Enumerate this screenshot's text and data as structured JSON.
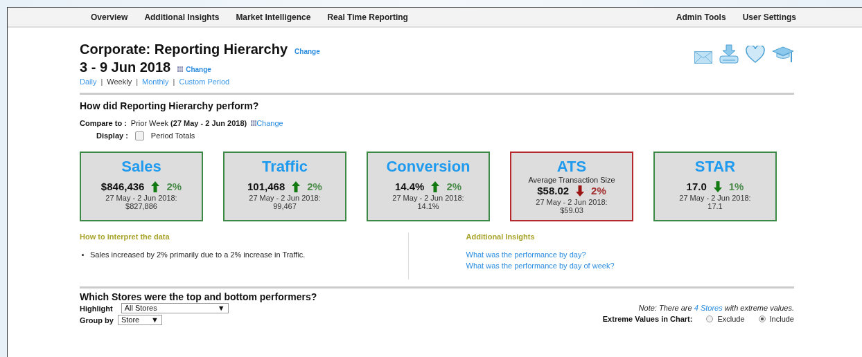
{
  "nav": {
    "left": [
      {
        "label": "Overview"
      },
      {
        "label": "Additional Insights"
      },
      {
        "label": "Market Intelligence"
      },
      {
        "label": "Real Time Reporting"
      }
    ],
    "right": [
      {
        "label": "Admin Tools"
      },
      {
        "label": "User Settings"
      }
    ]
  },
  "header": {
    "title": "Corporate: Reporting Hierarchy",
    "title_link": "Change",
    "period": "3 - 9 Jun 2018",
    "period_link": "Change",
    "separator": "|",
    "periods": [
      {
        "label": "Daily",
        "selected": false
      },
      {
        "label": "Weekly",
        "selected": true
      },
      {
        "label": "Monthly",
        "selected": false
      },
      {
        "label": "Custom Period",
        "selected": false
      }
    ]
  },
  "performance": {
    "heading": "How did Reporting Hierarchy perform?",
    "compare_label": "Compare to :",
    "compare_value": "Prior Week **(27 May - 2 Jun 2018)**",
    "compare_link": "Change",
    "display_label": "Display :",
    "display_option": {
      "label": "Period Totals",
      "checked": false
    }
  },
  "cards": [
    {
      "title": "Sales",
      "value": "$846,436",
      "rising": true,
      "favorable": true,
      "delta": "2%",
      "prior_label": "27 May - 2 Jun 2018:",
      "prior_value": "$827,886"
    },
    {
      "title": "Traffic",
      "value": "101,468",
      "rising": true,
      "favorable": true,
      "delta": "2%",
      "prior_label": "27 May - 2 Jun 2018:",
      "prior_value": "99,467"
    },
    {
      "title": "Conversion",
      "value": "14.4%",
      "rising": true,
      "favorable": true,
      "delta": "2%",
      "prior_label": "27 May - 2 Jun 2018:",
      "prior_value": "14.1%"
    },
    {
      "title": "ATS",
      "subtitle": "Average Transaction Size",
      "value": "$58.02",
      "rising": false,
      "favorable": false,
      "delta": "2%",
      "prior_label": "27 May - 2 Jun 2018:",
      "prior_value": "$59.03"
    },
    {
      "title": "STAR",
      "value": "17.0",
      "rising": false,
      "favorable": true,
      "delta": "1%",
      "prior_label": "27 May - 2 Jun 2018:",
      "prior_value": "17.1"
    }
  ],
  "interpret": {
    "heading": "How to interpret the data",
    "items": [
      "Sales increased by 2% primarily due to a 2% increase in Traffic."
    ]
  },
  "insights": {
    "heading": "Additional Insights",
    "links": [
      "What was the performance by day?",
      "What was the performance by day of week?"
    ]
  },
  "stores": {
    "heading": "Which Stores were the top and bottom performers?",
    "highlight_label": "Highlight",
    "highlight_value": "All Stores",
    "group_label": "Group by",
    "group_value": "Store",
    "caret": "▼",
    "note_before": "Note: There are ",
    "note_link": "4 Stores",
    "note_after": " with extreme values.",
    "extreme_label": "Extreme Values in Chart:",
    "extreme_options": [
      {
        "label": "Exclude",
        "selected": false
      },
      {
        "label": "Include",
        "selected": true
      }
    ]
  }
}
